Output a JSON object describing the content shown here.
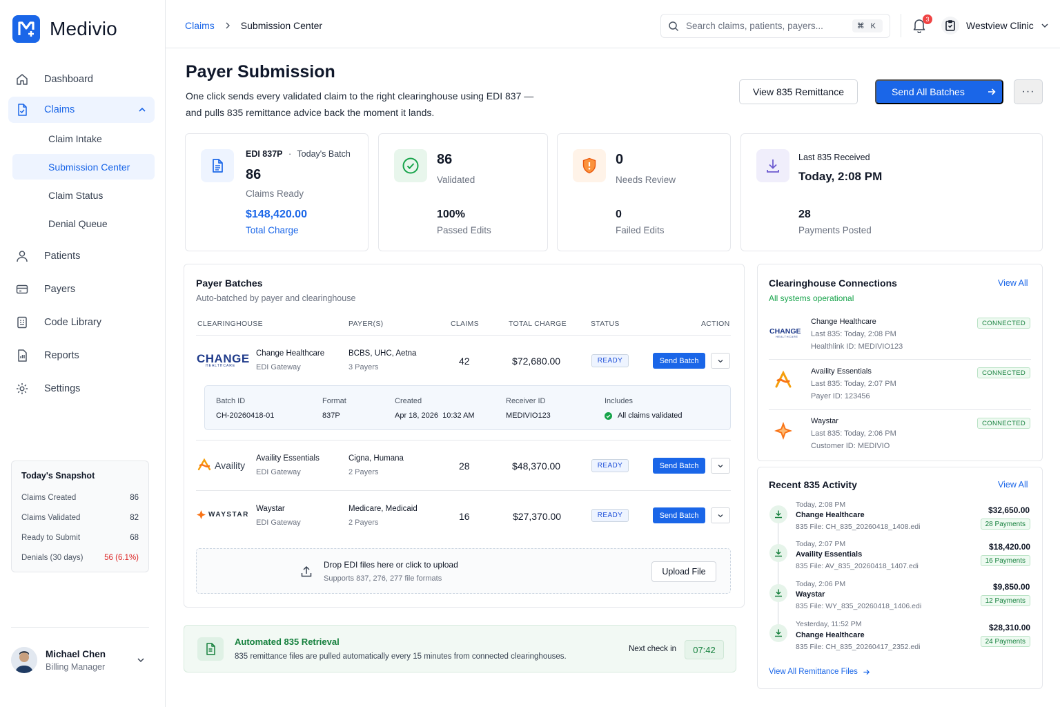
{
  "app": {
    "name": "Medivio",
    "logo_letter": "M"
  },
  "sidebar": {
    "items": [
      {
        "label": "Dashboard",
        "icon": "home-icon"
      },
      {
        "label": "Claims",
        "icon": "claims-icon",
        "active": true
      },
      {
        "label": "Patients",
        "icon": "user-icon"
      },
      {
        "label": "Payers",
        "icon": "wallet-icon"
      },
      {
        "label": "Code Library",
        "icon": "code-library-icon"
      },
      {
        "label": "Reports",
        "icon": "reports-icon"
      },
      {
        "label": "Settings",
        "icon": "gear-icon"
      }
    ],
    "claims_sub": [
      {
        "label": "Claim Intake"
      },
      {
        "label": "Submission Center",
        "active": true
      },
      {
        "label": "Claim Status"
      },
      {
        "label": "Denial Queue"
      }
    ],
    "snapshot": {
      "title": "Today's Snapshot",
      "rows": [
        {
          "label": "Claims Created",
          "value": "86"
        },
        {
          "label": "Claims Validated",
          "value": "82"
        },
        {
          "label": "Ready to Submit",
          "value": "68"
        },
        {
          "label": "Denials (30 days)",
          "value": "56 (6.1%)"
        }
      ]
    },
    "user": {
      "name": "Michael Chen",
      "role": "Billing Manager"
    }
  },
  "header": {
    "breadcrumb": [
      "Claims",
      "Submission Center"
    ],
    "search_placeholder": "Search claims, patients, payers...",
    "shortcut": "⌘ K",
    "notifications": "3",
    "clinic": "Westview Clinic"
  },
  "page": {
    "title": "Payer Submission",
    "description": "One click sends every validated claim to the right clearinghouse using EDI 837 — and pulls 835 remittance advice back the moment it lands.",
    "btn_view": "View 835 Remittance",
    "btn_send": "Send All Batches",
    "btn_more": "···"
  },
  "stats": {
    "batch": {
      "format": "EDI 837P",
      "sep": "·",
      "batch_label": "Today's Batch",
      "count": "86",
      "count_label": "Claims Ready",
      "charge": "$148,420.00",
      "charge_label": "Total Charge"
    },
    "validated": {
      "count": "86",
      "label": "Validated",
      "pct": "100%",
      "pct_label": "Passed Edits"
    },
    "review": {
      "count": "0",
      "label": "Needs Review",
      "failed": "0",
      "failed_label": "Failed Edits"
    },
    "last835": {
      "label": "Last 835 Received",
      "value": "Today, 2:08 PM",
      "payments": "28",
      "payments_label": "Payments Posted"
    }
  },
  "batches": {
    "title": "Payer Batches",
    "subtitle": "Auto-batched by payer and clearinghouse",
    "columns": [
      "CLEARINGHOUSE",
      "PAYER(S)",
      "CLAIMS",
      "TOTAL CHARGE",
      "STATUS",
      "ACTION"
    ],
    "rows": [
      {
        "logo": "CHANGE",
        "logo_sub": "HEALTHCARE",
        "name": "Change Healthcare",
        "gateway": "EDI Gateway",
        "payers": "BCBS, UHC, Aetna",
        "payer_count": "3 Payers",
        "claims": "42",
        "charge": "$72,680.00",
        "status": "READY",
        "action": "Send Batch"
      },
      {
        "logo": "Availity",
        "name": "Availity Essentials",
        "gateway": "EDI Gateway",
        "payers": "Cigna, Humana",
        "payer_count": "2 Payers",
        "claims": "28",
        "charge": "$48,370.00",
        "status": "READY",
        "action": "Send Batch"
      },
      {
        "logo": "WAYSTAR",
        "name": "Waystar",
        "gateway": "EDI Gateway",
        "payers": "Medicare, Medicaid",
        "payer_count": "2 Payers",
        "claims": "16",
        "charge": "$27,370.00",
        "status": "READY",
        "action": "Send Batch"
      }
    ],
    "detail": {
      "labels": [
        "Batch ID",
        "Format",
        "Created",
        "Receiver ID",
        "Includes"
      ],
      "values": [
        "CH-20260418-01",
        "837P",
        "Apr 18, 2026  10:32 AM",
        "MEDIVIO123",
        "All claims validated"
      ]
    },
    "upload": {
      "title": "Drop EDI files here or click to upload",
      "sub": "Supports 837, 276, 277 file formats",
      "button": "Upload File"
    }
  },
  "auto": {
    "title": "Automated 835 Retrieval",
    "desc": "835 remittance files are pulled automatically every 15 minutes from connected clearinghouses.",
    "next_label": "Next check in",
    "timer": "07:42"
  },
  "connections": {
    "title": "Clearinghouse Connections",
    "view_all": "View All",
    "status": "All systems operational",
    "items": [
      {
        "logo": "CHANGE",
        "logo_sub": "HEALTHCARE",
        "name": "Change Healthcare",
        "last": "Last 835: Today, 2:08 PM",
        "id": "Healthlink ID: MEDIVIO123",
        "status": "CONNECTED"
      },
      {
        "name": "Availity Essentials",
        "last": "Last 835: Today, 2:07 PM",
        "id": "Payer ID: 123456",
        "status": "CONNECTED"
      },
      {
        "name": "Waystar",
        "last": "Last 835: Today, 2:06 PM",
        "id": "Customer ID: MEDIVIO",
        "status": "CONNECTED"
      }
    ]
  },
  "activity": {
    "title": "Recent 835 Activity",
    "view_all": "View All",
    "footer": "View All Remittance Files",
    "items": [
      {
        "time": "Today, 2:08 PM",
        "name": "Change Healthcare",
        "file": "835 File: CH_835_20260418_1408.edi",
        "amount": "$32,650.00",
        "payments": "28 Payments"
      },
      {
        "time": "Today, 2:07 PM",
        "name": "Availity Essentials",
        "file": "835 File: AV_835_20260418_1407.edi",
        "amount": "$18,420.00",
        "payments": "16 Payments"
      },
      {
        "time": "Today, 2:06 PM",
        "name": "Waystar",
        "file": "835 File: WY_835_20260418_1406.edi",
        "amount": "$9,850.00",
        "payments": "12 Payments"
      },
      {
        "time": "Yesterday, 11:52 PM",
        "name": "Change Healthcare",
        "file": "835 File: CH_835_20260417_2352.edi",
        "amount": "$28,310.00",
        "payments": "24 Payments"
      }
    ]
  },
  "colors": {
    "accent": "#1a66e8",
    "success": "#15803d",
    "danger": "#dc2626",
    "warning": "#f97316",
    "violet": "#6d5bd0"
  }
}
